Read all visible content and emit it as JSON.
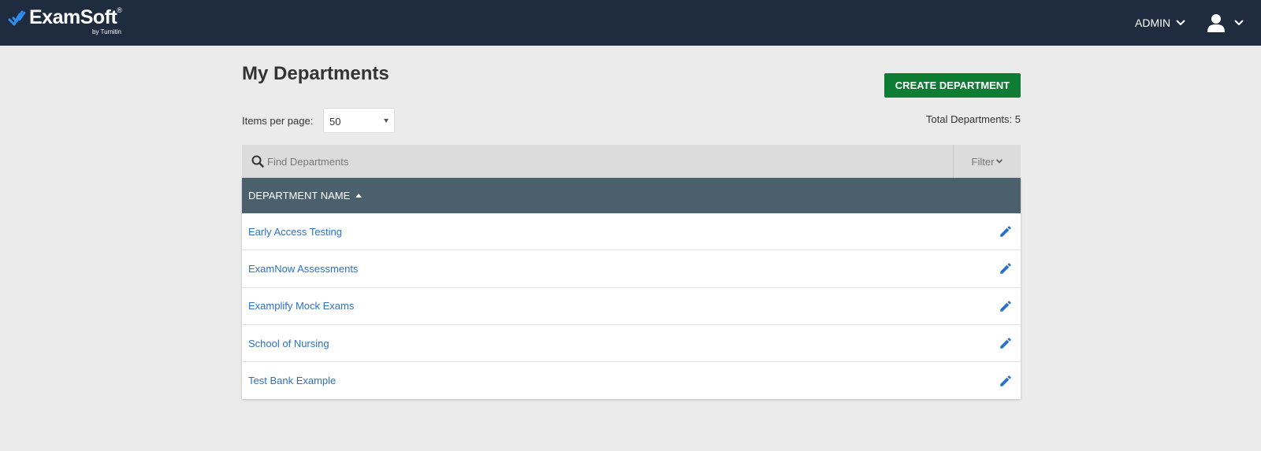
{
  "header": {
    "logo_text": "ExamSoft",
    "logo_tm": "®",
    "logo_sub": "by Turnitin",
    "admin_label": "ADMIN",
    "icons": {
      "logo": "examsoft-logo-icon",
      "admin_chevron": "chevron-down-icon",
      "user": "user-icon",
      "user_chevron": "chevron-down-icon"
    }
  },
  "page": {
    "title": "My Departments",
    "create_button": "CREATE DEPARTMENT",
    "items_per_page_label": "Items per page:",
    "items_per_page_value": "50",
    "total_label": "Total Departments: 5"
  },
  "search": {
    "placeholder": "Find Departments",
    "value": "",
    "filter_label": "Filter"
  },
  "table": {
    "header": "DEPARTMENT NAME",
    "sort": "ascending",
    "rows": [
      {
        "name": "Early Access Testing"
      },
      {
        "name": "ExamNow Assessments"
      },
      {
        "name": "Examplify Mock Exams"
      },
      {
        "name": "School of Nursing"
      },
      {
        "name": "Test Bank Example"
      }
    ]
  },
  "colors": {
    "topbar": "#1f2b3e",
    "create_button": "#0f7c34",
    "table_header": "#4b606d",
    "link": "#2d72c2",
    "logo_accent": "#2f8ff0",
    "background": "#ebebeb"
  }
}
